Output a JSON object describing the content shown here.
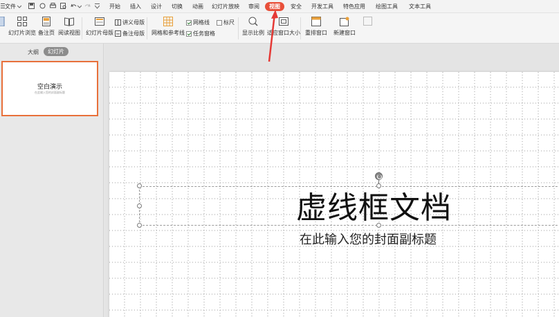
{
  "menubar": {
    "file_label": "文件",
    "tabs": [
      {
        "label": "开始",
        "active": false
      },
      {
        "label": "插入",
        "active": false
      },
      {
        "label": "设计",
        "active": false
      },
      {
        "label": "切换",
        "active": false
      },
      {
        "label": "动画",
        "active": false
      },
      {
        "label": "幻灯片放映",
        "active": false
      },
      {
        "label": "审阅",
        "active": false
      },
      {
        "label": "视图",
        "active": true
      },
      {
        "label": "安全",
        "active": false
      },
      {
        "label": "开发工具",
        "active": false
      },
      {
        "label": "特色应用",
        "active": false
      },
      {
        "label": "绘图工具",
        "active": false
      },
      {
        "label": "文本工具",
        "active": false
      }
    ]
  },
  "ribbon": {
    "slide_browse": "幻灯片浏览",
    "notes_page": "备注页",
    "reading_view": "阅读视图",
    "slide_master": "幻灯片母版",
    "handout_master": "讲义母版",
    "notes_master": "备注母版",
    "grid_guides": "网格和参考线",
    "gridlines_checkbox": "网格线",
    "taskpane_checkbox": "任务窗格",
    "ruler_checkbox": "标尺",
    "zoom": "显示比例",
    "fit_window": "适应窗口大小",
    "rearrange_window": "重排窗口",
    "new_window": "新建窗口",
    "checks": {
      "gridlines": true,
      "taskpane": true,
      "ruler": false
    }
  },
  "leftpanel": {
    "outline_tab": "大纲",
    "slides_tab": "幻灯片",
    "thumb_title": "空白演示",
    "thumb_subtitle": "在此输入您的封面副标题"
  },
  "slide": {
    "title": "虚线框文档",
    "subtitle": "在此输入您的封面副标题"
  },
  "colors": {
    "active_tab": "#e8503a",
    "thumb_border": "#e8703a",
    "arrow": "#e53935"
  }
}
